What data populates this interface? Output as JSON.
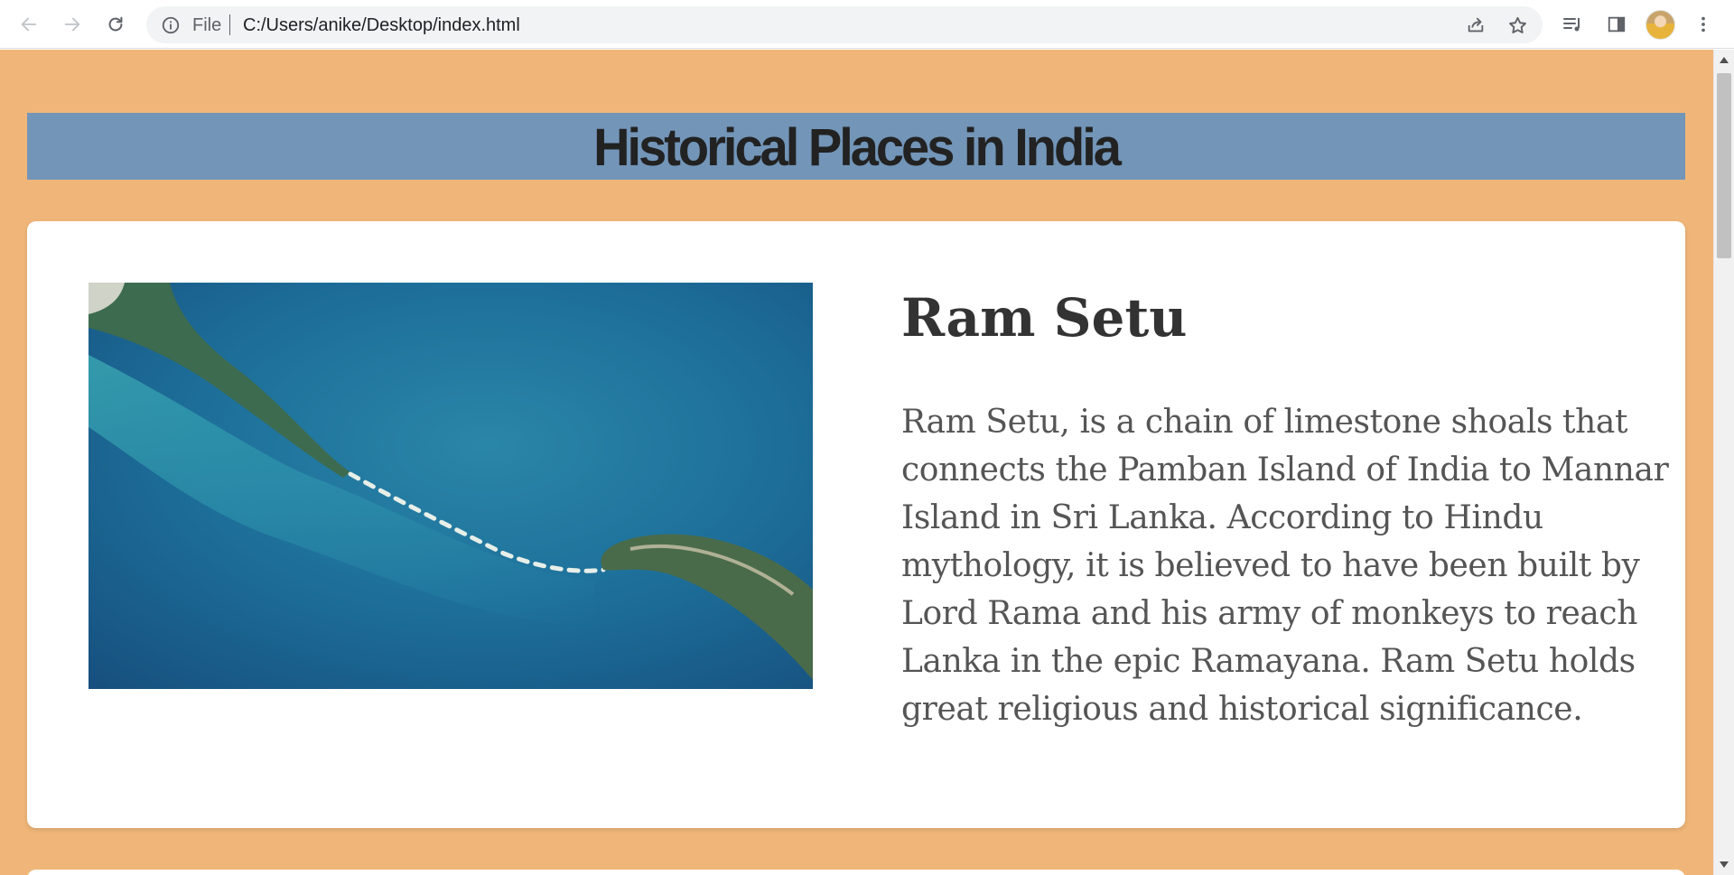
{
  "browser": {
    "omnibox": {
      "scheme_label": "File",
      "url": "C:/Users/anike/Desktop/index.html"
    }
  },
  "page": {
    "background_color": "#f0b679",
    "header": {
      "title": "Historical Places in India",
      "background_color": "#7295b8"
    },
    "cards": [
      {
        "heading": "Ram Setu",
        "description": "Ram Setu, is a chain of limestone shoals that connects the Pamban Island of India to Mannar Island in Sri Lanka. According to Hindu mythology, it is believed to have been built by Lord Rama and his army of monkeys to reach Lanka in the epic Ramayana. Ram Setu holds great religious and historical significance."
      }
    ]
  }
}
